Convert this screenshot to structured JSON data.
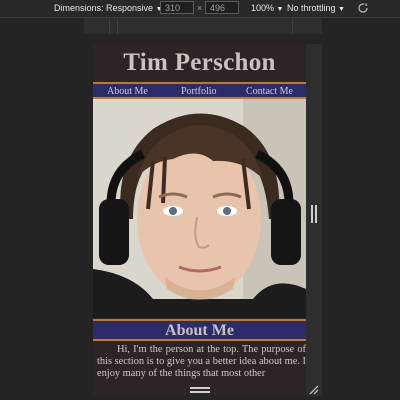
{
  "devtools": {
    "dimensions_label": "Dimensions: Responsive",
    "width_value": "310",
    "times_symbol": "×",
    "height_value": "496",
    "zoom_label": "100%",
    "throttle_label": "No throttling"
  },
  "site": {
    "title": "Tim Perschon",
    "nav": [
      "About Me",
      "Portfolio",
      "Contact Me"
    ],
    "section_title": "About Me",
    "about_text": "Hi, I'm the person at the top. The purpose of this section is to give you a better idea about me. I enjoy many of the things that most other"
  },
  "colors": {
    "page_bg": "#2b2527",
    "nav_bg": "#2d2c6b",
    "accent_border": "#c07a22",
    "text": "#c9c2c0"
  },
  "icons": {
    "rotate": "rotate-icon",
    "dropdown": "chevron-down-icon"
  }
}
